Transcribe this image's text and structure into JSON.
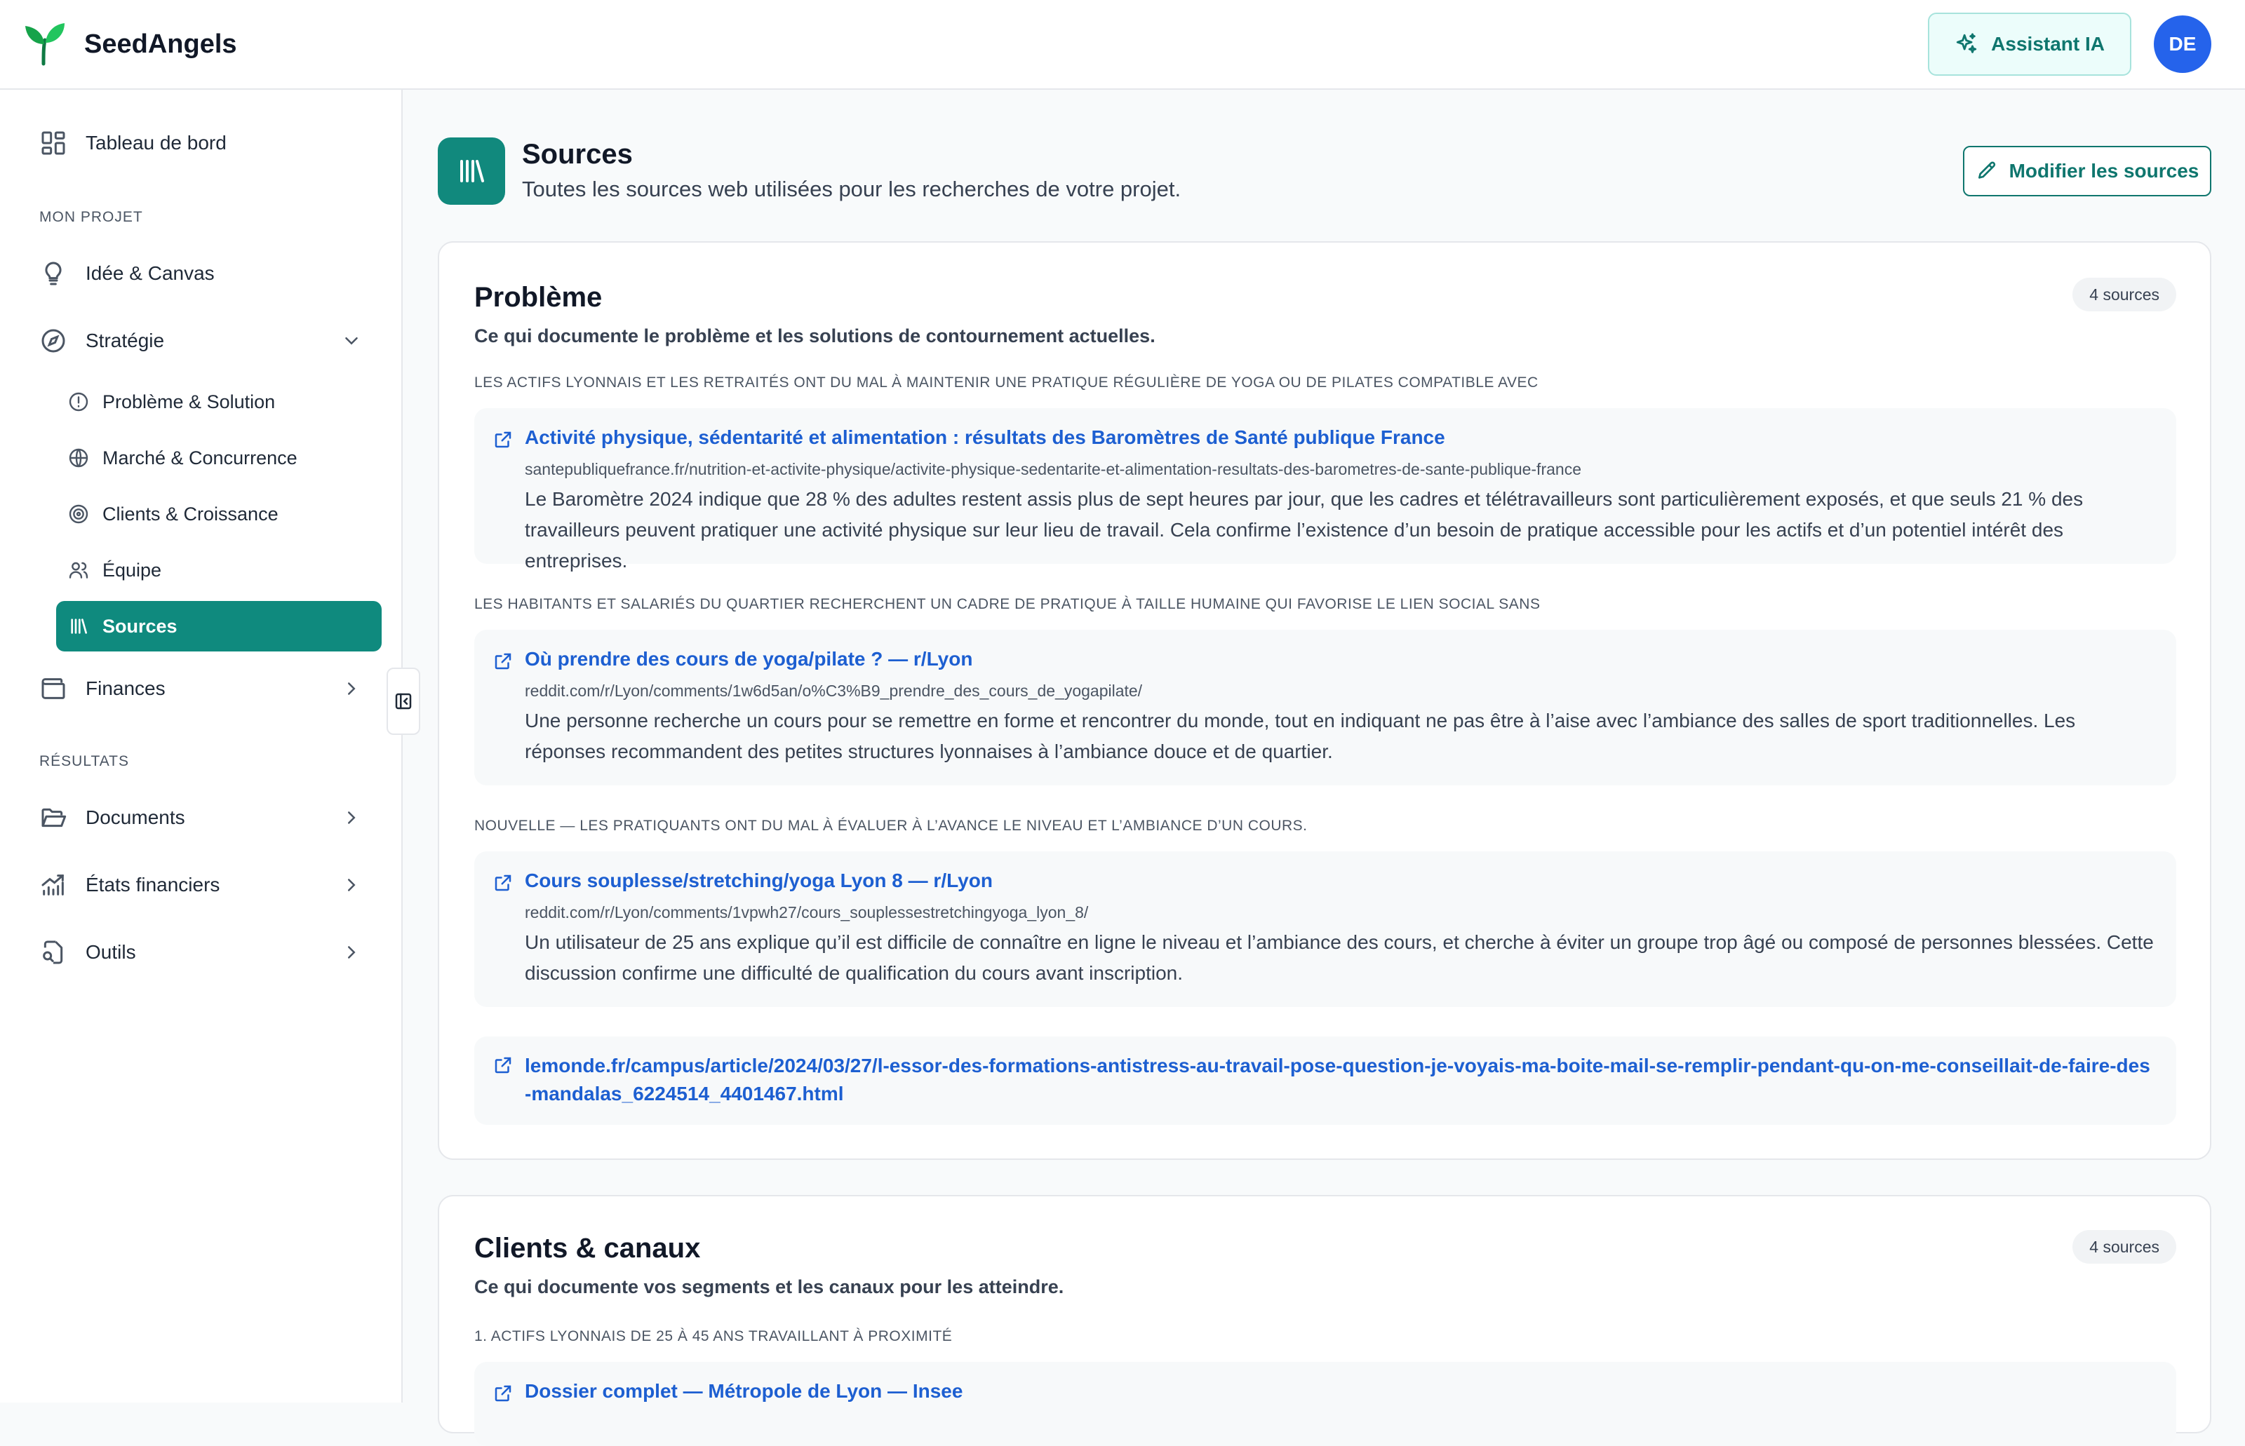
{
  "header": {
    "brand": "SeedAngels",
    "assistant_label": "Assistant IA",
    "avatar_initials": "DE",
    "accent_color": "#0f8a7e",
    "avatar_color": "#2563eb"
  },
  "sidebar": {
    "dashboard": "Tableau de bord",
    "section_project": "MON PROJET",
    "idea": "Idée & Canvas",
    "strategy": "Stratégie",
    "strategy_items": {
      "problem": "Problème & Solution",
      "market": "Marché & Concurrence",
      "clients": "Clients & Croissance",
      "team": "Équipe",
      "sources": "Sources"
    },
    "finances": "Finances",
    "section_results": "RÉSULTATS",
    "documents": "Documents",
    "statements": "États financiers",
    "tools": "Outils"
  },
  "page": {
    "title": "Sources",
    "subtitle": "Toutes les sources web utilisées pour les recherches de votre projet.",
    "edit_button": "Modifier les sources"
  },
  "cards": {
    "problem": {
      "title": "Problème",
      "description": "Ce qui documente le problème et les solutions de contournement actuelles.",
      "badge": "4 sources",
      "claim1": "LES ACTIFS LYONNAIS ET LES RETRAITÉS ONT DU MAL À MAINTENIR UNE PRATIQUE RÉGULIÈRE DE YOGA OU DE PILATES COMPATIBLE AVEC",
      "src1": {
        "title": "Activité physique, sédentarité et alimentation : résultats des Baromètres de Santé publique France",
        "url": "santepubliquefrance.fr/nutrition-et-activite-physique/activite-physique-sedentarite-et-alimentation-resultats-des-barometres-de-sante-publique-france",
        "text": "Le Baromètre 2024 indique que 28 % des adultes restent assis plus de sept heures par jour, que les cadres et télétravailleurs sont particulièrement exposés, et que seuls 21 % des travailleurs peuvent pratiquer une activité physique sur leur lieu de travail. Cela confirme l’existence d’un besoin de pratique accessible pour les actifs et d’un potentiel intérêt des entreprises."
      },
      "claim2": "LES HABITANTS ET SALARIÉS DU QUARTIER RECHERCHENT UN CADRE DE PRATIQUE À TAILLE HUMAINE QUI FAVORISE LE LIEN SOCIAL SANS",
      "src2": {
        "title": "Où prendre des cours de yoga/pilate ? — r/Lyon",
        "url": "reddit.com/r/Lyon/comments/1w6d5an/o%C3%B9_prendre_des_cours_de_yogapilate/",
        "text": "Une personne recherche un cours pour se remettre en forme et rencontrer du monde, tout en indiquant ne pas être à l’aise avec l’ambiance des salles de sport traditionnelles. Les réponses recommandent des petites structures lyonnaises à l’ambiance douce et de quartier."
      },
      "claim3": "NOUVELLE — LES PRATIQUANTS ONT DU MAL À ÉVALUER À L’AVANCE LE NIVEAU ET L’AMBIANCE D’UN COURS.",
      "src3": {
        "title": "Cours souplesse/stretching/yoga Lyon 8 — r/Lyon",
        "url": "reddit.com/r/Lyon/comments/1vpwh27/cours_souplessestretchingyoga_lyon_8/",
        "text": "Un utilisateur de 25 ans explique qu’il est difficile de connaître en ligne le niveau et l’ambiance des cours, et cherche à éviter un groupe trop âgé ou composé de personnes blessées. Cette discussion confirme une difficulté de qualification du cours avant inscription."
      },
      "src4": {
        "title": "lemonde.fr/campus/article/2024/03/27/l-essor-des-formations-antistress-au-travail-pose-question-je-voyais-ma-boite-mail-se-remplir-pendant-qu-on-me-conseillait-de-faire-des-mandalas_6224514_4401467.html"
      }
    },
    "clients": {
      "title": "Clients & canaux",
      "description": "Ce qui documente vos segments et les canaux pour les atteindre.",
      "badge": "4 sources",
      "claim1": "1. ACTIFS LYONNAIS DE 25 À 45 ANS TRAVAILLANT À PROXIMITÉ",
      "src1": {
        "title": "Dossier complet — Métropole de Lyon — Insee"
      }
    }
  }
}
